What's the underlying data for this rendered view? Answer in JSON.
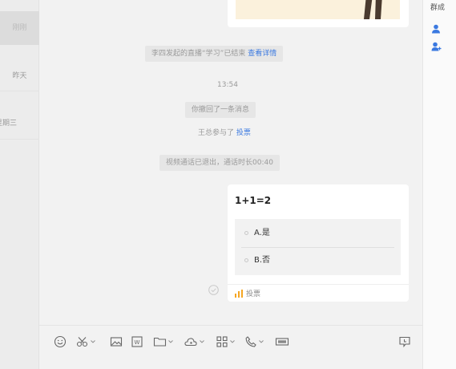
{
  "sidebar": {
    "items": [
      {
        "label": "刚刚"
      },
      {
        "label": "昨天"
      },
      {
        "label": "星期三"
      }
    ]
  },
  "chat": {
    "live_notice": {
      "text": "李四发起的直播“学习”已结束 ",
      "link": "查看详情"
    },
    "time": "13:54",
    "recall_notice": "你撤回了一条消息",
    "vote_join": {
      "text": "王总参与了 ",
      "link": "投票"
    },
    "call_notice": "视频通话已退出，通话时长00:40",
    "vote_card": {
      "title": "1+1=2",
      "options": [
        "A.是",
        "B.否"
      ],
      "footer_label": "投票"
    }
  },
  "right_panel": {
    "title": "群成"
  },
  "toolbar": {
    "icons": [
      "emoji-icon",
      "scissors-icon",
      "image-icon",
      "word-doc-icon",
      "folder-icon",
      "cloud-icon",
      "apps-grid-icon",
      "phone-icon",
      "live-icon",
      "screen-message-icon"
    ]
  },
  "colors": {
    "link": "#3b79e0",
    "accent_blue": "#3b79e0",
    "vote_bars": "#f5a623"
  }
}
